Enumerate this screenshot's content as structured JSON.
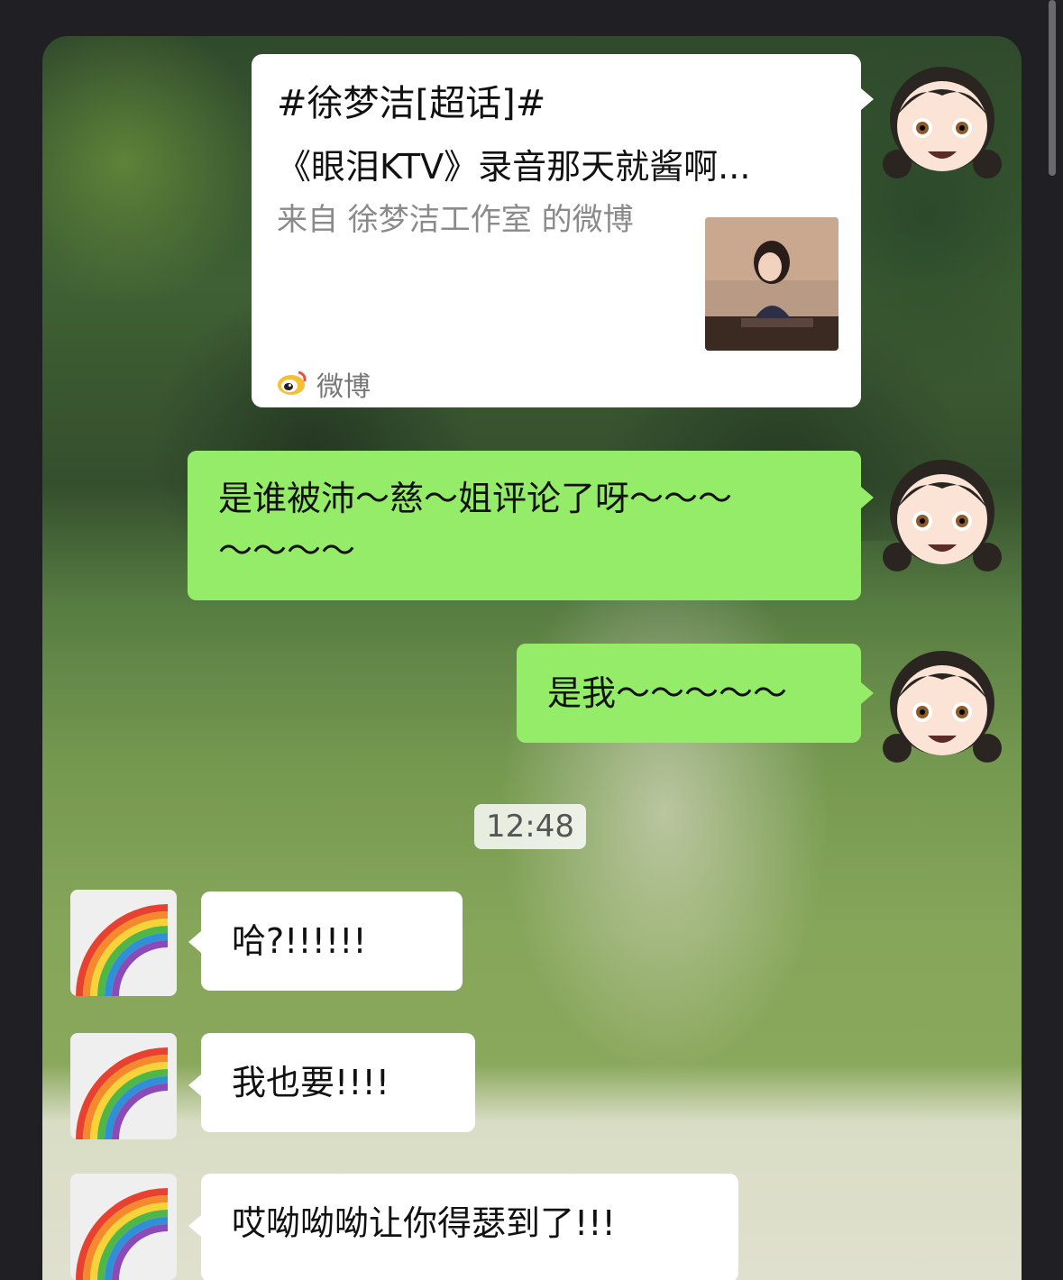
{
  "card": {
    "title": "#徐梦洁[超话]#",
    "description": "《眼泪KTV》录音那天就酱啊...",
    "source": "来自 徐梦洁工作室 的微博",
    "app_label": "微博"
  },
  "messages": {
    "m1": {
      "line1": "是谁被沛～慈～姐评论了呀～～～",
      "line2": "～～～～"
    },
    "m2": "是我～～～～～",
    "m3": "哈?!!!!!!",
    "m4": "我也要!!!!",
    "m5": "哎呦呦呦让你得瑟到了!!!"
  },
  "timestamp": "12:48",
  "colors": {
    "sent_bubble": "#95ec69",
    "received_bubble": "#ffffff",
    "chat_frame": "#1f1f24"
  },
  "icons": {
    "self_avatar": "girl-emoji-avatar",
    "other_avatar": "rainbow-emoji-avatar",
    "card_app": "weibo-icon"
  }
}
